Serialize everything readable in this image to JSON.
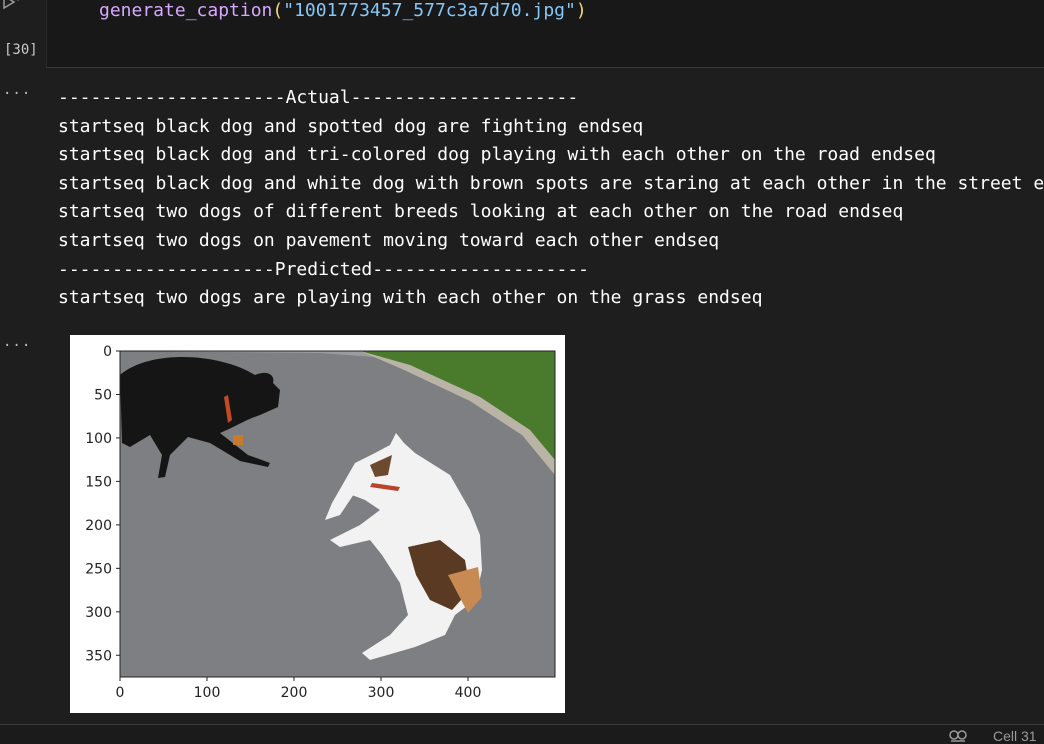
{
  "cell": {
    "execution_count": "[30]",
    "code": {
      "function": "generate_caption",
      "open_paren": "(",
      "argument": "\"1001773457_577c3a7d70.jpg\"",
      "close_paren": ")"
    }
  },
  "output": {
    "collapsed_indicator": "···",
    "lines": [
      "---------------------Actual---------------------",
      "startseq black dog and spotted dog are fighting endseq",
      "startseq black dog and tri-colored dog playing with each other on the road endseq",
      "startseq black dog and white dog with brown spots are staring at each other in the street endseq",
      "startseq two dogs of different breeds looking at each other on the road endseq",
      "startseq two dogs on pavement moving toward each other endseq",
      "--------------------Predicted--------------------",
      "startseq two dogs are playing with each other on the grass endseq"
    ]
  },
  "figure": {
    "collapsed_indicator": "···",
    "image_subject": "black dog and white-brown dog on a road",
    "y_ticks": [
      "0",
      "50",
      "100",
      "150",
      "200",
      "250",
      "300",
      "350"
    ],
    "x_ticks": [
      "0",
      "100",
      "200",
      "300",
      "400"
    ],
    "xlim": [
      0,
      500
    ],
    "ylim": [
      375,
      0
    ],
    "colors": {
      "road": "#7e7f82",
      "grass": "#4a7a2c",
      "black_dog": "#151515",
      "white_dog": "#f2f2f2",
      "brown_patch": "#5a3a22"
    }
  },
  "status_bar": {
    "icon": "copilot-icon",
    "cell_label": "Cell 31"
  }
}
